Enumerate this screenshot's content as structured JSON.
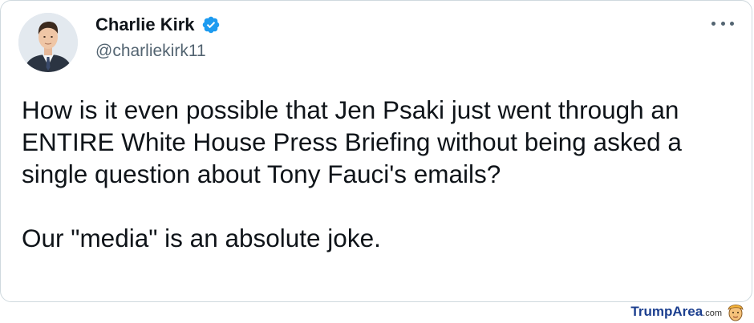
{
  "tweet": {
    "author_name": "Charlie Kirk",
    "author_handle": "@charliekirk11",
    "paragraphs": [
      "How is it even possible that Jen Psaki just went through an ENTIRE White House Press Briefing without being asked a single question about Tony Fauci's emails?",
      "Our \"media\" is an absolute joke."
    ],
    "verified": true,
    "icons": {
      "verified": "verified-badge-icon",
      "more": "more-options-icon"
    },
    "colors": {
      "verified_badge": "#1d9bf0",
      "name_text": "#0f1419",
      "handle_text": "#536471"
    }
  },
  "watermark": {
    "brand": "TrumpArea",
    "suffix": ".com",
    "color": "#1c3f8f"
  }
}
